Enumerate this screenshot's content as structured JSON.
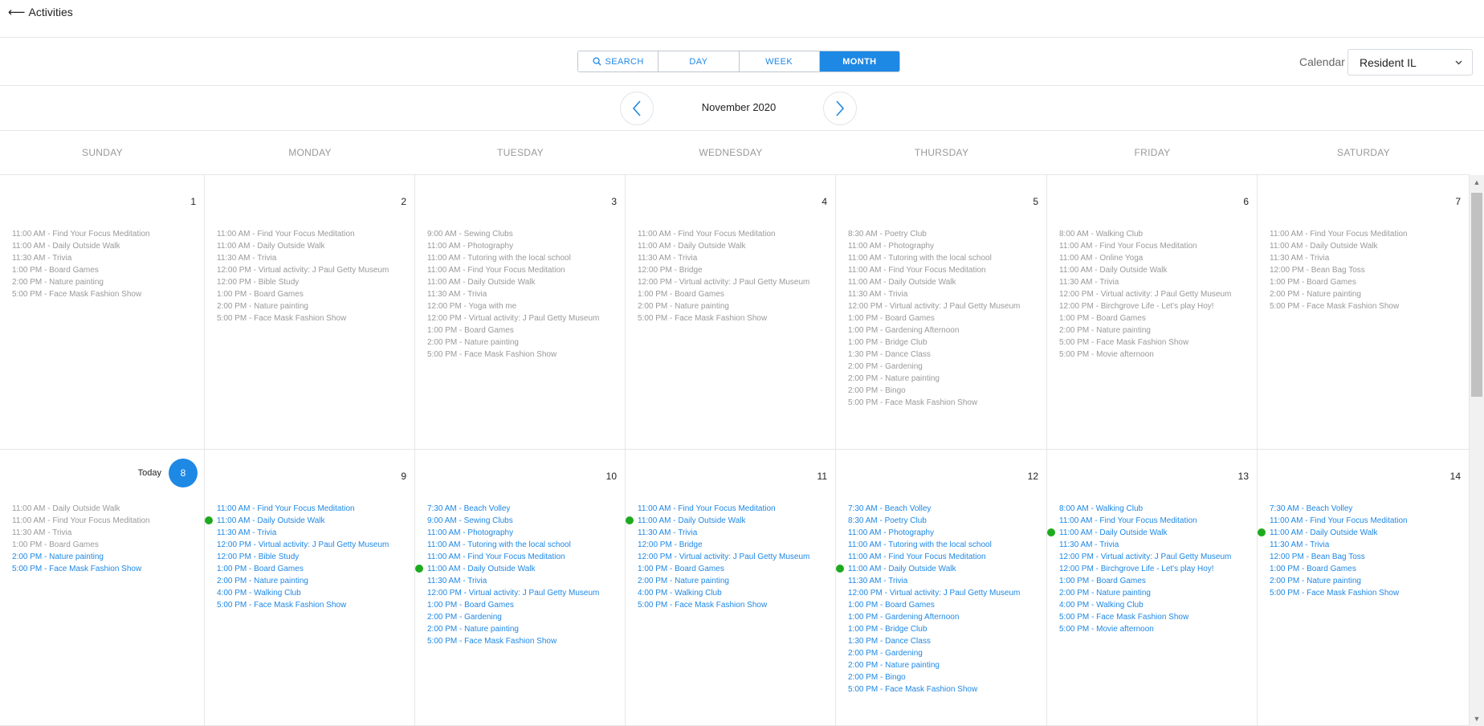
{
  "header": {
    "back_arrow": "⟵",
    "back_label": "Activities"
  },
  "toolbar": {
    "views": [
      {
        "label": "SEARCH",
        "icon": "search-icon"
      },
      {
        "label": "DAY"
      },
      {
        "label": "WEEK"
      },
      {
        "label": "MONTH",
        "active": true
      }
    ],
    "calendar_label": "Calendar",
    "calendar_value": "Resident IL"
  },
  "month": {
    "title": "November 2020"
  },
  "weekdays": [
    "SUNDAY",
    "MONDAY",
    "TUESDAY",
    "WEDNESDAY",
    "THURSDAY",
    "FRIDAY",
    "SATURDAY"
  ],
  "today_label": "Today",
  "colors": {
    "accent": "#1e88e5",
    "past_event": "#9a9a9a",
    "live_dot": "#1eaa1e"
  },
  "weeks": [
    [
      {
        "day": "1",
        "events": [
          {
            "text": "11:00 AM - Find Your Focus Meditation"
          },
          {
            "text": "11:00 AM - Daily Outside Walk"
          },
          {
            "text": "11:30 AM - Trivia"
          },
          {
            "text": "1:00 PM - Board Games"
          },
          {
            "text": "2:00 PM - Nature painting"
          },
          {
            "text": "5:00 PM - Face Mask Fashion Show"
          }
        ]
      },
      {
        "day": "2",
        "events": [
          {
            "text": "11:00 AM - Find Your Focus Meditation"
          },
          {
            "text": "11:00 AM - Daily Outside Walk"
          },
          {
            "text": "11:30 AM - Trivia"
          },
          {
            "text": "12:00 PM - Virtual activity: J Paul Getty Museum"
          },
          {
            "text": "12:00 PM - Bible Study"
          },
          {
            "text": "1:00 PM - Board Games"
          },
          {
            "text": "2:00 PM - Nature painting"
          },
          {
            "text": "5:00 PM - Face Mask Fashion Show"
          }
        ]
      },
      {
        "day": "3",
        "events": [
          {
            "text": "9:00 AM - Sewing Clubs"
          },
          {
            "text": "11:00 AM - Photography"
          },
          {
            "text": "11:00 AM - Tutoring with the local school"
          },
          {
            "text": "11:00 AM - Find Your Focus Meditation"
          },
          {
            "text": "11:00 AM - Daily Outside Walk"
          },
          {
            "text": "11:30 AM - Trivia"
          },
          {
            "text": "12:00 PM - Yoga with me"
          },
          {
            "text": "12:00 PM - Virtual activity: J Paul Getty Museum"
          },
          {
            "text": "1:00 PM - Board Games"
          },
          {
            "text": "2:00 PM - Nature painting"
          },
          {
            "text": "5:00 PM - Face Mask Fashion Show"
          }
        ]
      },
      {
        "day": "4",
        "events": [
          {
            "text": "11:00 AM - Find Your Focus Meditation"
          },
          {
            "text": "11:00 AM - Daily Outside Walk"
          },
          {
            "text": "11:30 AM - Trivia"
          },
          {
            "text": "12:00 PM - Bridge"
          },
          {
            "text": "12:00 PM - Virtual activity: J Paul Getty Museum"
          },
          {
            "text": "1:00 PM - Board Games"
          },
          {
            "text": "2:00 PM - Nature painting"
          },
          {
            "text": "5:00 PM - Face Mask Fashion Show"
          }
        ]
      },
      {
        "day": "5",
        "events": [
          {
            "text": "8:30 AM - Poetry Club"
          },
          {
            "text": "11:00 AM - Photography"
          },
          {
            "text": "11:00 AM - Tutoring with the local school"
          },
          {
            "text": "11:00 AM - Find Your Focus Meditation"
          },
          {
            "text": "11:00 AM - Daily Outside Walk"
          },
          {
            "text": "11:30 AM - Trivia"
          },
          {
            "text": "12:00 PM - Virtual activity: J Paul Getty Museum"
          },
          {
            "text": "1:00 PM - Board Games"
          },
          {
            "text": "1:00 PM - Gardening Afternoon"
          },
          {
            "text": "1:00 PM - Bridge Club"
          },
          {
            "text": "1:30 PM - Dance Class"
          },
          {
            "text": "2:00 PM - Gardening"
          },
          {
            "text": "2:00 PM - Nature painting"
          },
          {
            "text": "2:00 PM - Bingo"
          },
          {
            "text": "5:00 PM - Face Mask Fashion Show"
          }
        ]
      },
      {
        "day": "6",
        "events": [
          {
            "text": "8:00 AM - Walking Club"
          },
          {
            "text": "11:00 AM - Find Your Focus Meditation"
          },
          {
            "text": "11:00 AM - Online Yoga"
          },
          {
            "text": "11:00 AM - Daily Outside Walk"
          },
          {
            "text": "11:30 AM - Trivia"
          },
          {
            "text": "12:00 PM - Virtual activity: J Paul Getty Museum"
          },
          {
            "text": "12:00 PM - Birchgrove Life - Let's play Hoy!"
          },
          {
            "text": "1:00 PM - Board Games"
          },
          {
            "text": "2:00 PM - Nature painting"
          },
          {
            "text": "5:00 PM - Face Mask Fashion Show"
          },
          {
            "text": "5:00 PM - Movie afternoon"
          }
        ]
      },
      {
        "day": "7",
        "events": [
          {
            "text": "11:00 AM - Find Your Focus Meditation"
          },
          {
            "text": "11:00 AM - Daily Outside Walk"
          },
          {
            "text": "11:30 AM - Trivia"
          },
          {
            "text": "12:00 PM - Bean Bag Toss"
          },
          {
            "text": "1:00 PM - Board Games"
          },
          {
            "text": "2:00 PM - Nature painting"
          },
          {
            "text": "5:00 PM - Face Mask Fashion Show"
          }
        ]
      }
    ],
    [
      {
        "day": "8",
        "today": true,
        "events": [
          {
            "text": "11:00 AM - Daily Outside Walk"
          },
          {
            "text": "11:00 AM - Find Your Focus Meditation"
          },
          {
            "text": "11:30 AM - Trivia"
          },
          {
            "text": "1:00 PM - Board Games"
          },
          {
            "text": "2:00 PM - Nature painting",
            "upcoming": true
          },
          {
            "text": "5:00 PM - Face Mask Fashion Show",
            "upcoming": true
          }
        ]
      },
      {
        "day": "9",
        "events": [
          {
            "text": "11:00 AM - Find Your Focus Meditation",
            "upcoming": true
          },
          {
            "text": "11:00 AM - Daily Outside Walk",
            "upcoming": true,
            "dot": true
          },
          {
            "text": "11:30 AM - Trivia",
            "upcoming": true
          },
          {
            "text": "12:00 PM - Virtual activity: J Paul Getty Museum",
            "upcoming": true
          },
          {
            "text": "12:00 PM - Bible Study",
            "upcoming": true
          },
          {
            "text": "1:00 PM - Board Games",
            "upcoming": true
          },
          {
            "text": "2:00 PM - Nature painting",
            "upcoming": true
          },
          {
            "text": "4:00 PM - Walking Club",
            "upcoming": true
          },
          {
            "text": "5:00 PM - Face Mask Fashion Show",
            "upcoming": true
          }
        ]
      },
      {
        "day": "10",
        "events": [
          {
            "text": "7:30 AM - Beach Volley",
            "upcoming": true
          },
          {
            "text": "9:00 AM - Sewing Clubs",
            "upcoming": true
          },
          {
            "text": "11:00 AM - Photography",
            "upcoming": true
          },
          {
            "text": "11:00 AM - Tutoring with the local school",
            "upcoming": true
          },
          {
            "text": "11:00 AM - Find Your Focus Meditation",
            "upcoming": true
          },
          {
            "text": "11:00 AM - Daily Outside Walk",
            "upcoming": true,
            "dot": true
          },
          {
            "text": "11:30 AM - Trivia",
            "upcoming": true
          },
          {
            "text": "12:00 PM - Virtual activity: J Paul Getty Museum",
            "upcoming": true
          },
          {
            "text": "1:00 PM - Board Games",
            "upcoming": true
          },
          {
            "text": "2:00 PM - Gardening",
            "upcoming": true
          },
          {
            "text": "2:00 PM - Nature painting",
            "upcoming": true
          },
          {
            "text": "5:00 PM - Face Mask Fashion Show",
            "upcoming": true
          }
        ]
      },
      {
        "day": "11",
        "events": [
          {
            "text": "11:00 AM - Find Your Focus Meditation",
            "upcoming": true
          },
          {
            "text": "11:00 AM - Daily Outside Walk",
            "upcoming": true,
            "dot": true
          },
          {
            "text": "11:30 AM - Trivia",
            "upcoming": true
          },
          {
            "text": "12:00 PM - Bridge",
            "upcoming": true
          },
          {
            "text": "12:00 PM - Virtual activity: J Paul Getty Museum",
            "upcoming": true
          },
          {
            "text": "1:00 PM - Board Games",
            "upcoming": true
          },
          {
            "text": "2:00 PM - Nature painting",
            "upcoming": true
          },
          {
            "text": "4:00 PM - Walking Club",
            "upcoming": true
          },
          {
            "text": "5:00 PM - Face Mask Fashion Show",
            "upcoming": true
          }
        ]
      },
      {
        "day": "12",
        "events": [
          {
            "text": "7:30 AM - Beach Volley",
            "upcoming": true
          },
          {
            "text": "8:30 AM - Poetry Club",
            "upcoming": true
          },
          {
            "text": "11:00 AM - Photography",
            "upcoming": true
          },
          {
            "text": "11:00 AM - Tutoring with the local school",
            "upcoming": true
          },
          {
            "text": "11:00 AM - Find Your Focus Meditation",
            "upcoming": true
          },
          {
            "text": "11:00 AM - Daily Outside Walk",
            "upcoming": true,
            "dot": true
          },
          {
            "text": "11:30 AM - Trivia",
            "upcoming": true
          },
          {
            "text": "12:00 PM - Virtual activity: J Paul Getty Museum",
            "upcoming": true
          },
          {
            "text": "1:00 PM - Board Games",
            "upcoming": true
          },
          {
            "text": "1:00 PM - Gardening Afternoon",
            "upcoming": true
          },
          {
            "text": "1:00 PM - Bridge Club",
            "upcoming": true
          },
          {
            "text": "1:30 PM - Dance Class",
            "upcoming": true
          },
          {
            "text": "2:00 PM - Gardening",
            "upcoming": true
          },
          {
            "text": "2:00 PM - Nature painting",
            "upcoming": true
          },
          {
            "text": "2:00 PM - Bingo",
            "upcoming": true
          },
          {
            "text": "5:00 PM - Face Mask Fashion Show",
            "upcoming": true
          }
        ]
      },
      {
        "day": "13",
        "events": [
          {
            "text": "8:00 AM - Walking Club",
            "upcoming": true
          },
          {
            "text": "11:00 AM - Find Your Focus Meditation",
            "upcoming": true
          },
          {
            "text": "11:00 AM - Daily Outside Walk",
            "upcoming": true,
            "dot": true
          },
          {
            "text": "11:30 AM - Trivia",
            "upcoming": true
          },
          {
            "text": "12:00 PM - Virtual activity: J Paul Getty Museum",
            "upcoming": true
          },
          {
            "text": "12:00 PM - Birchgrove Life - Let's play Hoy!",
            "upcoming": true
          },
          {
            "text": "1:00 PM - Board Games",
            "upcoming": true
          },
          {
            "text": "2:00 PM - Nature painting",
            "upcoming": true
          },
          {
            "text": "4:00 PM - Walking Club",
            "upcoming": true
          },
          {
            "text": "5:00 PM - Face Mask Fashion Show",
            "upcoming": true
          },
          {
            "text": "5:00 PM - Movie afternoon",
            "upcoming": true
          }
        ]
      },
      {
        "day": "14",
        "events": [
          {
            "text": "7:30 AM - Beach Volley",
            "upcoming": true
          },
          {
            "text": "11:00 AM - Find Your Focus Meditation",
            "upcoming": true
          },
          {
            "text": "11:00 AM - Daily Outside Walk",
            "upcoming": true,
            "dot": true
          },
          {
            "text": "11:30 AM - Trivia",
            "upcoming": true
          },
          {
            "text": "12:00 PM - Bean Bag Toss",
            "upcoming": true
          },
          {
            "text": "1:00 PM - Board Games",
            "upcoming": true
          },
          {
            "text": "2:00 PM - Nature painting",
            "upcoming": true
          },
          {
            "text": "5:00 PM - Face Mask Fashion Show",
            "upcoming": true
          }
        ]
      }
    ]
  ]
}
